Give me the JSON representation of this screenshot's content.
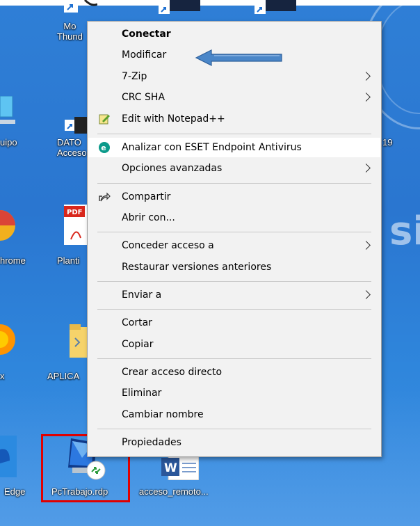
{
  "desktop": {
    "icons": [
      {
        "label": "Mo\nThund"
      },
      {
        "label": "uipo"
      },
      {
        "label": "DATO\nAcceso"
      },
      {
        "label": "hrome"
      },
      {
        "label": "Planti"
      },
      {
        "label": "x"
      },
      {
        "label": "APLICA"
      },
      {
        "label": "Edge"
      },
      {
        "label": "PcTrabajo.rdp"
      },
      {
        "label": "acceso_remoto..."
      },
      {
        "label": "19"
      }
    ],
    "background_text": {
      "side": "sid"
    }
  },
  "context_menu": {
    "items": [
      {
        "label": "Conectar",
        "bold": true
      },
      {
        "label": "Modificar"
      },
      {
        "label": "7-Zip",
        "submenu": true
      },
      {
        "label": "CRC SHA",
        "submenu": true
      },
      {
        "label": "Edit with Notepad++",
        "icon": "notepadpp-icon"
      },
      {
        "label": "Analizar con ESET Endpoint Antivirus",
        "icon": "eset-icon"
      },
      {
        "label": "Opciones avanzadas",
        "submenu": true
      },
      {
        "label": "Compartir",
        "icon": "share-icon"
      },
      {
        "label": "Abrir con..."
      },
      {
        "label": "Conceder acceso a",
        "submenu": true
      },
      {
        "label": "Restaurar versiones anteriores"
      },
      {
        "label": "Enviar a",
        "submenu": true
      },
      {
        "label": "Cortar"
      },
      {
        "label": "Copiar"
      },
      {
        "label": "Crear acceso directo"
      },
      {
        "label": "Eliminar"
      },
      {
        "label": "Cambiar nombre"
      },
      {
        "label": "Propiedades"
      }
    ]
  },
  "colors": {
    "desktop_blue": "#2f7fd6",
    "menu_bg": "#f2f2f2",
    "highlight_red": "#e00000",
    "callout_arrow": "#4a86c8",
    "eset_teal": "#0b9a8a"
  }
}
